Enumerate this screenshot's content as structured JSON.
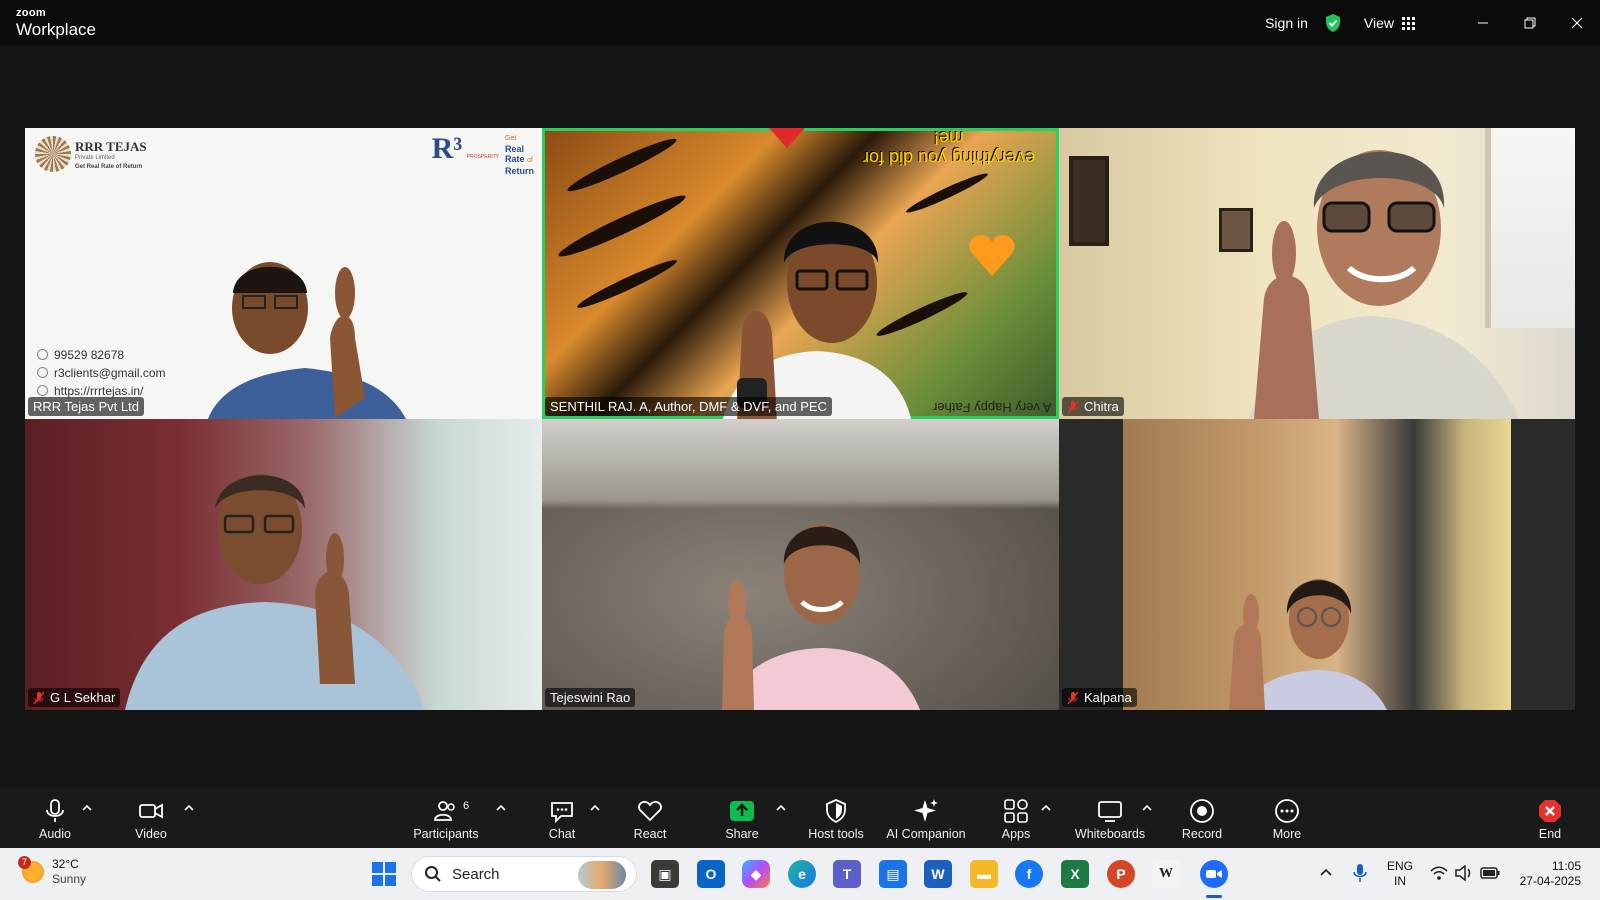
{
  "window": {
    "brand_small": "zoom",
    "brand_big": "Workplace",
    "sign_in": "Sign in",
    "view": "View"
  },
  "tiles": [
    {
      "name": "RRR Tejas Pvt Ltd",
      "muted": false
    },
    {
      "name": "SENTHIL RAJ. A, Author, DMF & DVF, and PEC",
      "muted": false,
      "active": true
    },
    {
      "name": "Chitra",
      "muted": true
    },
    {
      "name": "G L Sekhar",
      "muted": true
    },
    {
      "name": "Tejeswini Rao",
      "muted": false
    },
    {
      "name": "Kalpana",
      "muted": true
    }
  ],
  "tile1": {
    "company": "RRR TEJAS",
    "company_sub": "Private Limited",
    "tagline": "Get Real Rate of Return",
    "r3_get": "Get",
    "r3_real": "Real",
    "r3_rate": "Rate",
    "r3_of": "of",
    "r3_return": "Return",
    "r3_prop": "PROSPERITY",
    "phone": "99529 82678",
    "email": "r3clients@gmail.com",
    "web": "https://rrrtejas.in/"
  },
  "tile2": {
    "quote": "everything you did for me!",
    "bottom": "A very Happy Father"
  },
  "controls": {
    "audio": "Audio",
    "video": "Video",
    "participants": "Participants",
    "participants_count": "6",
    "chat": "Chat",
    "react": "React",
    "share": "Share",
    "host_tools": "Host tools",
    "ai_companion": "AI Companion",
    "apps": "Apps",
    "whiteboards": "Whiteboards",
    "record": "Record",
    "more": "More",
    "end": "End"
  },
  "taskbar": {
    "temp": "32°C",
    "condition": "Sunny",
    "weather_badge": "7",
    "search": "Search",
    "lang1": "ENG",
    "lang2": "IN",
    "time": "11:05",
    "date": "27-04-2025"
  },
  "colors": {
    "active_border": "#23d160",
    "share_green": "#0bbd4e",
    "end_red": "#e5322d",
    "zoom_blue": "#1f6bff"
  }
}
